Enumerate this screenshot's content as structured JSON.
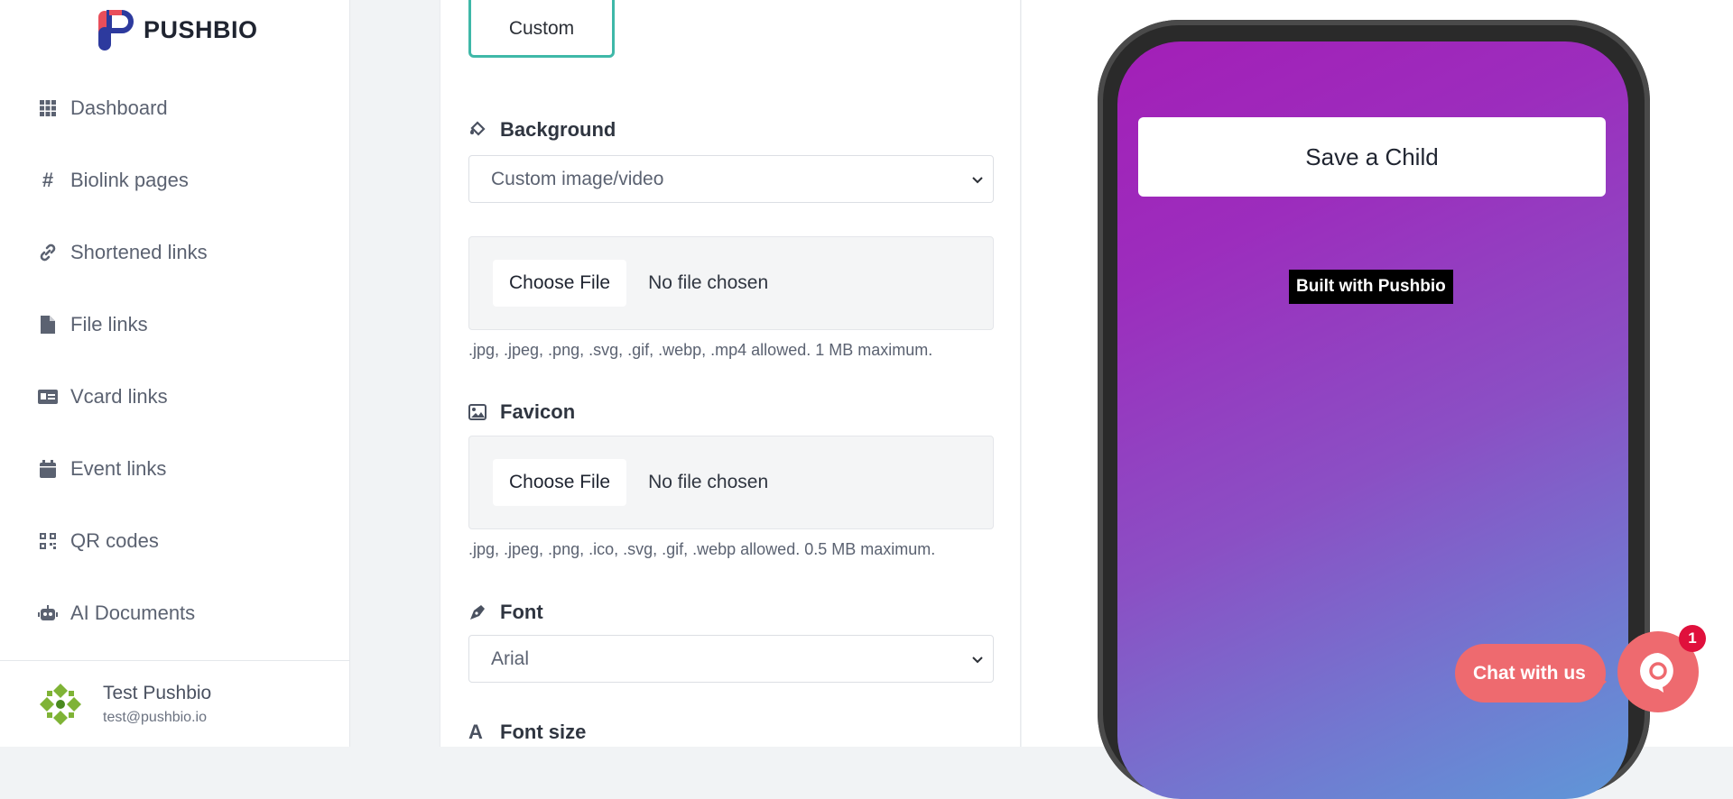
{
  "brand": {
    "name": "PUSHBIO"
  },
  "sidebar": {
    "items": [
      {
        "label": "Dashboard",
        "icon": "grid-icon"
      },
      {
        "label": "Biolink pages",
        "icon": "hash-icon"
      },
      {
        "label": "Shortened links",
        "icon": "link-icon"
      },
      {
        "label": "File links",
        "icon": "file-icon"
      },
      {
        "label": "Vcard links",
        "icon": "id-card-icon"
      },
      {
        "label": "Event links",
        "icon": "calendar-icon"
      },
      {
        "label": "QR codes",
        "icon": "qr-code-icon"
      },
      {
        "label": "AI Documents",
        "icon": "robot-icon"
      }
    ],
    "user": {
      "name": "Test Pushbio",
      "email": "test@pushbio.io"
    }
  },
  "form": {
    "theme_option": "Custom",
    "background": {
      "label": "Background",
      "value": "Custom image/video"
    },
    "background_file": {
      "button": "Choose File",
      "status": "No file chosen",
      "hint": ".jpg, .jpeg, .png, .svg, .gif, .webp, .mp4 allowed. 1 MB maximum."
    },
    "favicon": {
      "label": "Favicon",
      "button": "Choose File",
      "status": "No file chosen",
      "hint": ".jpg, .jpeg, .png, .ico, .svg, .gif, .webp allowed. 0.5 MB maximum."
    },
    "font": {
      "label": "Font",
      "value": "Arial"
    },
    "font_size": {
      "label": "Font size"
    }
  },
  "preview": {
    "link_button": "Save a Child",
    "branding": "Built with Pushbio"
  },
  "chat": {
    "label": "Chat with us",
    "badge": "1"
  },
  "colors": {
    "accent": "#3fb8a8",
    "chat": "#ee6a6f",
    "badge": "#e0103c",
    "annotation": "#ff0000"
  }
}
